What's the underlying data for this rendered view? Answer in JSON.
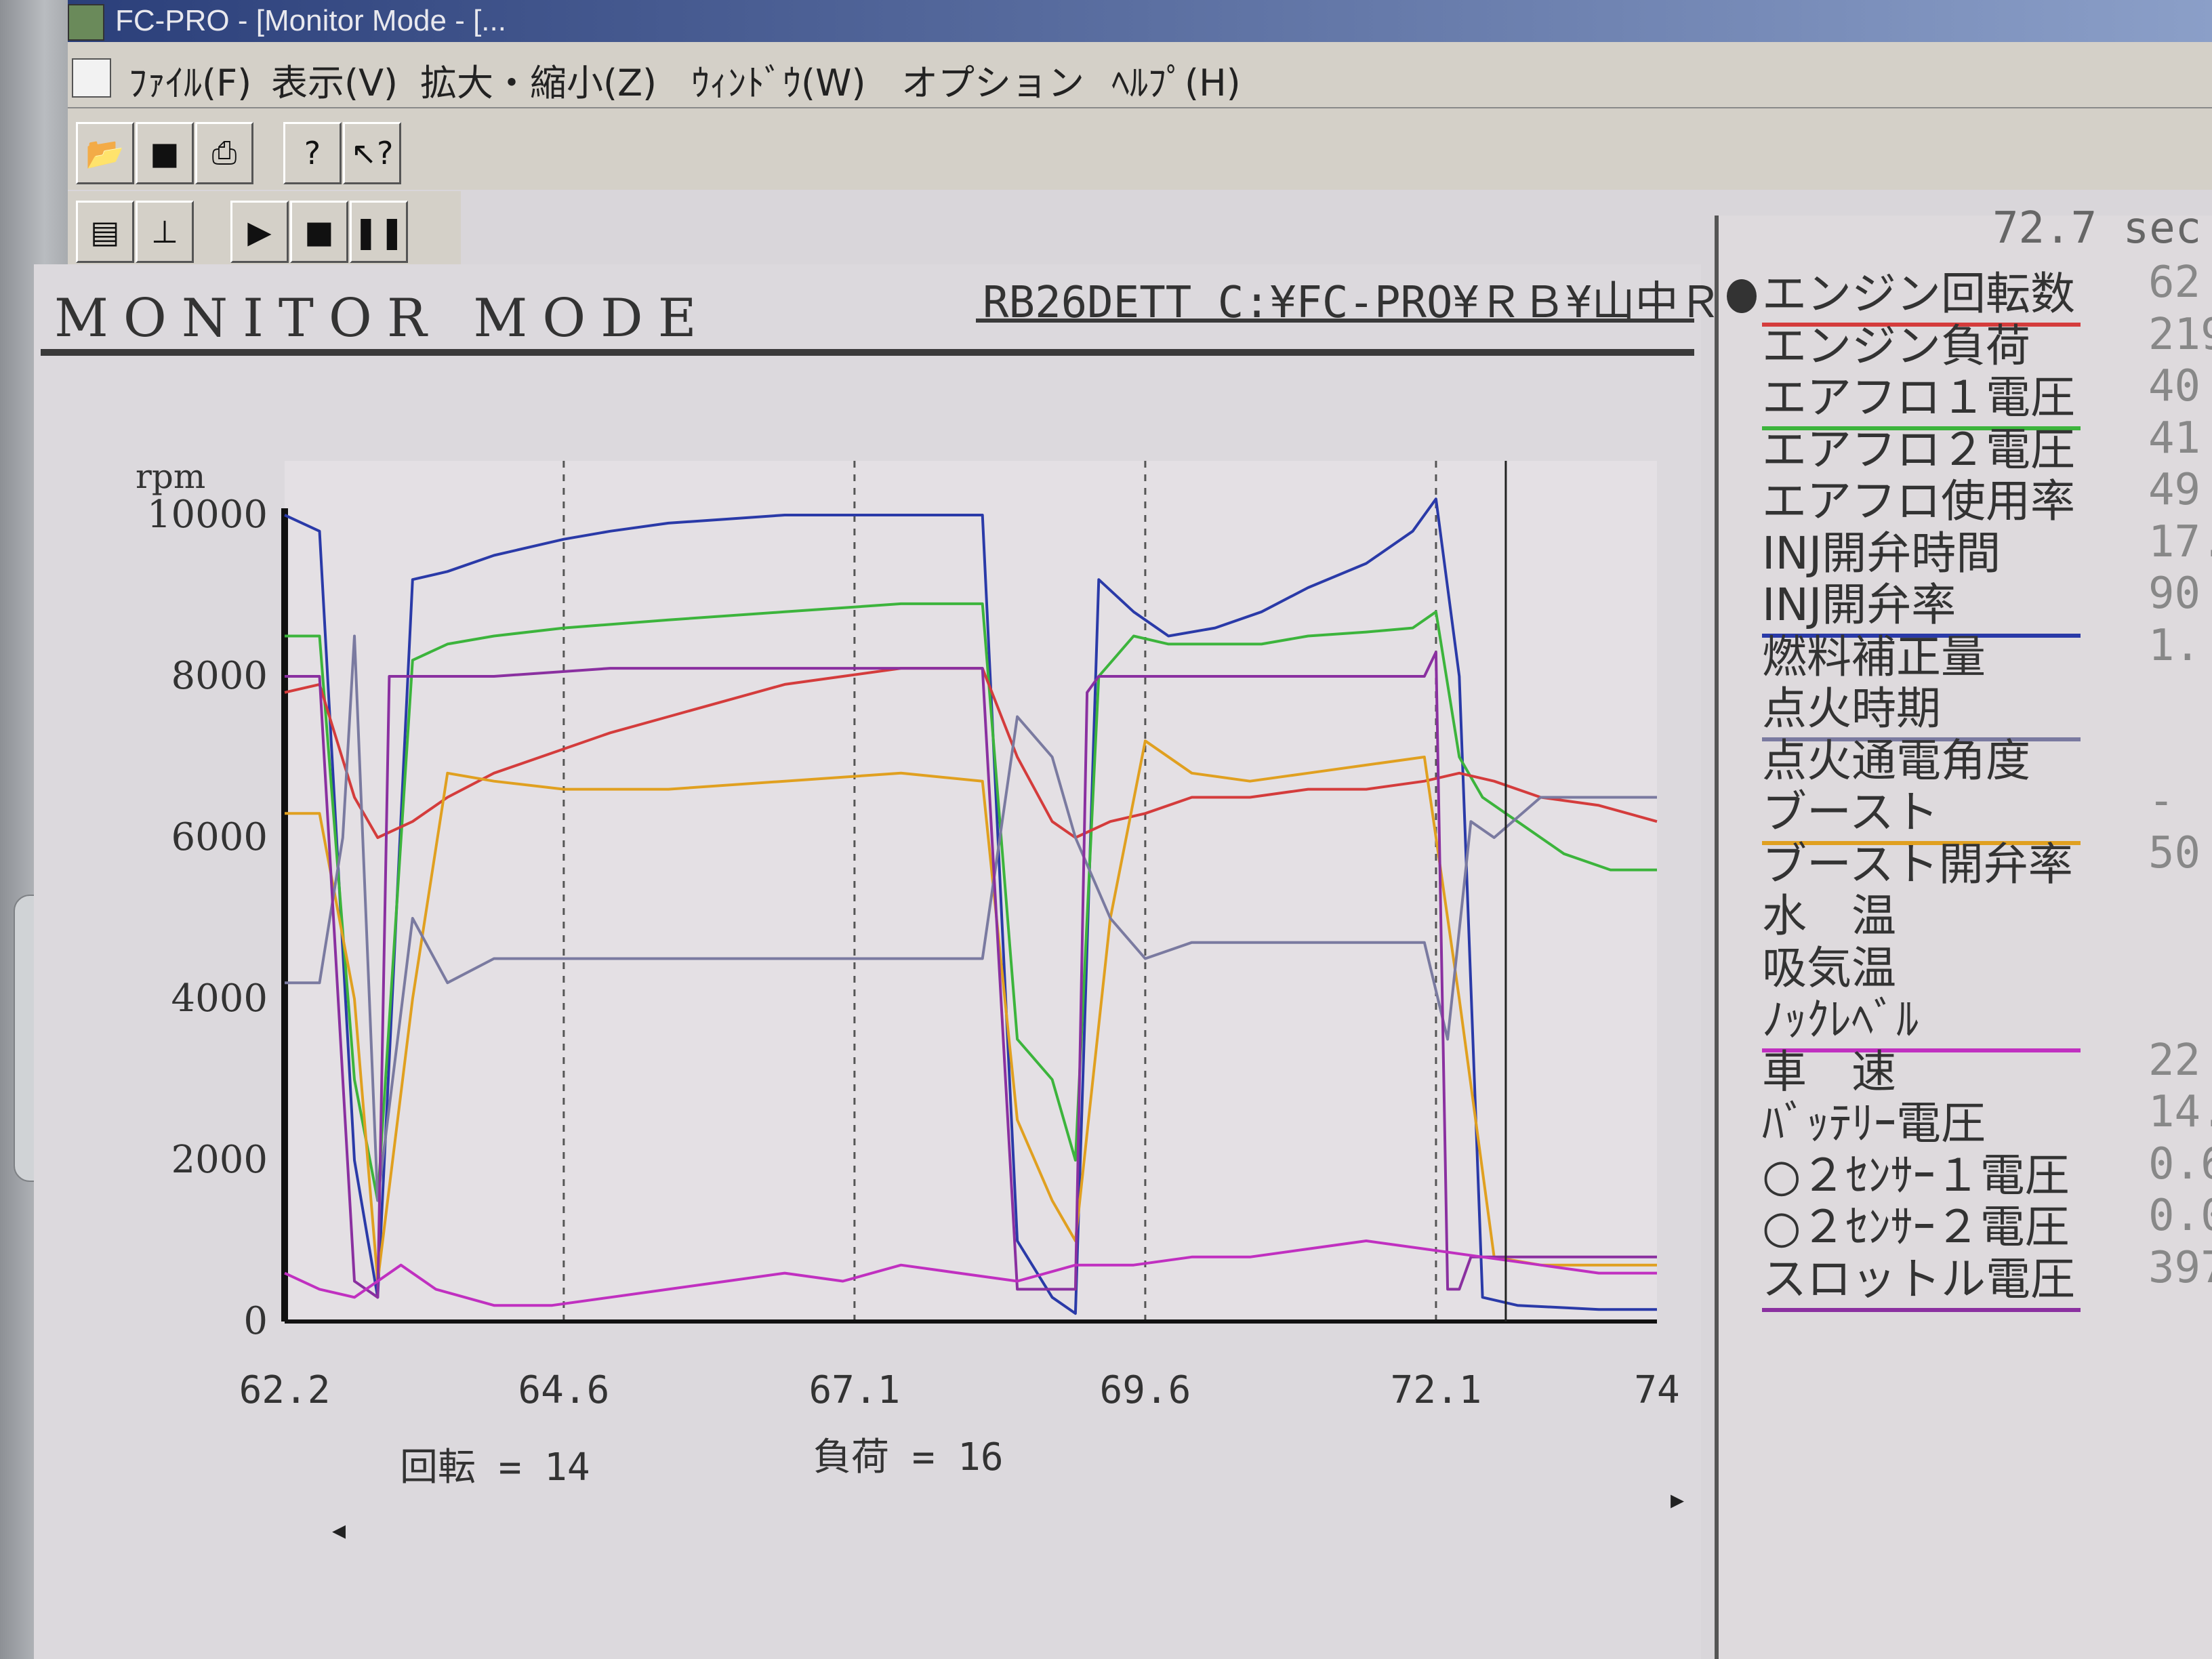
{
  "window": {
    "title": "FC-PRO - [Monitor Mode - [..."
  },
  "menu": [
    {
      "id": "file",
      "label": "ﾌｧｲﾙ(F)"
    },
    {
      "id": "view",
      "label": "表示(V)"
    },
    {
      "id": "zoom",
      "label": "拡大・縮小(Z)"
    },
    {
      "id": "window",
      "label": "ｳｨﾝﾄﾞｳ(W)"
    },
    {
      "id": "options",
      "label": "オプション"
    },
    {
      "id": "help",
      "label": "ﾍﾙﾌﾟ(H)"
    }
  ],
  "toolbar": {
    "open_icon": "folder-open-icon",
    "save_icon": "floppy-icon",
    "print_icon": "printer-icon",
    "help_icon": "question-icon",
    "context_help_icon": "context-help-icon",
    "chart_icon": "chart-icon",
    "marker_icon": "marker-icon",
    "play_icon": "play-icon",
    "stop_icon": "stop-icon",
    "pause_icon": "pause-icon"
  },
  "monitor": {
    "mode_title": "MONITOR MODE",
    "file_path": "RB26DETT C:¥FC-PRO¥ＲＢ¥山中Ｒ３",
    "time_readout": "72.7 sec"
  },
  "status": {
    "rev_label": "回転 = 14",
    "load_label": "負荷 = 16"
  },
  "params": [
    {
      "name": "エンジン回転数",
      "value": "62",
      "color": "#d43c3c",
      "selected": true
    },
    {
      "name": "エンジン負荷",
      "value": "219",
      "color": ""
    },
    {
      "name": "エアフロ１電圧",
      "value": "40",
      "color": "#3cb43c"
    },
    {
      "name": "エアフロ２電圧",
      "value": "41",
      "color": ""
    },
    {
      "name": "エアフロ使用率",
      "value": "49",
      "color": ""
    },
    {
      "name": "INJ開弁時間",
      "value": "17.",
      "color": ""
    },
    {
      "name": "INJ開弁率",
      "value": "90",
      "color": "#2a3aa8"
    },
    {
      "name": "燃料補正量",
      "value": "1.",
      "color": ""
    },
    {
      "name": "点火時期",
      "value": "",
      "color": "#7a7aa0"
    },
    {
      "name": "点火通電角度",
      "value": "",
      "color": ""
    },
    {
      "name": "ブースト",
      "value": "-",
      "color": "#e0a020"
    },
    {
      "name": "ブースト開弁率",
      "value": "50",
      "color": ""
    },
    {
      "name": "水　温",
      "value": "",
      "color": ""
    },
    {
      "name": "吸気温",
      "value": "",
      "color": ""
    },
    {
      "name": "ﾉｯｸﾚﾍﾞﾙ",
      "value": "",
      "color": "#c030c0"
    },
    {
      "name": "車　速",
      "value": "22",
      "color": ""
    },
    {
      "name": "ﾊﾞｯﾃﾘｰ電圧",
      "value": "14.",
      "color": ""
    },
    {
      "name": "○２ｾﾝｻｰ１電圧",
      "value": "0.6",
      "color": ""
    },
    {
      "name": "○２ｾﾝｻｰ２電圧",
      "value": "0.0",
      "color": ""
    },
    {
      "name": "スロットル電圧",
      "value": "397",
      "color": "#8a30a0"
    }
  ],
  "chart_data": {
    "type": "line",
    "title": "",
    "xlabel": "",
    "ylabel": "rpm",
    "ylim": [
      0,
      10000
    ],
    "xlim": [
      62.2,
      74
    ],
    "x_ticks": [
      "62.2",
      "64.6",
      "67.1",
      "69.6",
      "72.1",
      "74"
    ],
    "y_ticks": [
      "0",
      "2000",
      "4000",
      "6000",
      "8000",
      "10000"
    ],
    "grid": "vertical dashed",
    "cursor_x": 72.7,
    "series": [
      {
        "name": "INJ開弁率",
        "color": "#2a3aa8",
        "x": [
          62.2,
          62.5,
          62.8,
          63.0,
          63.3,
          63.6,
          64.0,
          64.6,
          65.0,
          65.5,
          66.0,
          66.5,
          67.0,
          67.5,
          68.2,
          68.5,
          68.8,
          69.0,
          69.2,
          69.5,
          69.8,
          70.2,
          70.6,
          71.0,
          71.5,
          71.9,
          72.1,
          72.3,
          72.5,
          72.8,
          73.5,
          74.0
        ],
        "y": [
          10000,
          9800,
          2000,
          300,
          9200,
          9300,
          9500,
          9700,
          9800,
          9900,
          9950,
          10000,
          10000,
          10000,
          10000,
          1000,
          300,
          100,
          9200,
          8800,
          8500,
          8600,
          8800,
          9100,
          9400,
          9800,
          10200,
          8000,
          300,
          200,
          150,
          150
        ]
      },
      {
        "name": "エアフロ１電圧",
        "color": "#3cb43c",
        "x": [
          62.2,
          62.5,
          62.8,
          63.0,
          63.3,
          63.6,
          64.0,
          64.6,
          65.5,
          66.5,
          67.5,
          68.2,
          68.5,
          68.8,
          69.0,
          69.2,
          69.5,
          69.8,
          70.2,
          70.6,
          71.0,
          71.5,
          71.9,
          72.1,
          72.3,
          72.5,
          72.8,
          73.2,
          73.6,
          74.0
        ],
        "y": [
          8500,
          8500,
          3000,
          1500,
          8200,
          8400,
          8500,
          8600,
          8700,
          8800,
          8900,
          8900,
          3500,
          3000,
          2000,
          8000,
          8500,
          8400,
          8400,
          8400,
          8500,
          8550,
          8600,
          8800,
          7000,
          6500,
          6200,
          5800,
          5600,
          5600
        ]
      },
      {
        "name": "エンジン回転数",
        "color": "#d43c3c",
        "x": [
          62.2,
          62.5,
          62.8,
          63.0,
          63.3,
          63.6,
          64.0,
          64.6,
          65.0,
          65.5,
          66.0,
          66.5,
          67.0,
          67.5,
          68.2,
          68.5,
          68.8,
          69.0,
          69.3,
          69.6,
          70.0,
          70.5,
          71.0,
          71.5,
          72.0,
          72.3,
          72.6,
          73.0,
          73.5,
          74.0
        ],
        "y": [
          7800,
          7900,
          6500,
          6000,
          6200,
          6500,
          6800,
          7100,
          7300,
          7500,
          7700,
          7900,
          8000,
          8100,
          8100,
          7000,
          6200,
          6000,
          6200,
          6300,
          6500,
          6500,
          6600,
          6600,
          6700,
          6800,
          6700,
          6500,
          6400,
          6200
        ]
      },
      {
        "name": "ブースト",
        "color": "#e0a020",
        "x": [
          62.2,
          62.5,
          62.8,
          63.0,
          63.3,
          63.6,
          64.0,
          64.6,
          65.5,
          66.5,
          67.5,
          68.2,
          68.5,
          68.8,
          69.0,
          69.3,
          69.6,
          70.0,
          70.5,
          71.0,
          71.5,
          72.0,
          72.3,
          72.6,
          73.0,
          73.5,
          74.0
        ],
        "y": [
          6300,
          6300,
          4000,
          500,
          4000,
          6800,
          6700,
          6600,
          6600,
          6700,
          6800,
          6700,
          2500,
          1500,
          1000,
          5000,
          7200,
          6800,
          6700,
          6800,
          6900,
          7000,
          4000,
          800,
          700,
          700,
          700
        ]
      },
      {
        "name": "点火時期",
        "color": "#7a7aa0",
        "x": [
          62.2,
          62.5,
          62.7,
          62.8,
          63.0,
          63.3,
          63.6,
          64.0,
          64.6,
          65.5,
          66.5,
          67.5,
          68.2,
          68.5,
          68.8,
          69.0,
          69.3,
          69.6,
          70.0,
          70.5,
          71.0,
          71.5,
          72.0,
          72.2,
          72.4,
          72.6,
          73.0,
          73.5,
          74.0
        ],
        "y": [
          4200,
          4200,
          6000,
          8500,
          1500,
          5000,
          4200,
          4500,
          4500,
          4500,
          4500,
          4500,
          4500,
          7500,
          7000,
          6000,
          5000,
          4500,
          4700,
          4700,
          4700,
          4700,
          4700,
          3500,
          6200,
          6000,
          6500,
          6500,
          6500
        ]
      },
      {
        "name": "スロットル電圧",
        "color": "#8a30a0",
        "x": [
          62.2,
          62.5,
          62.8,
          63.0,
          63.1,
          63.2,
          63.5,
          64.0,
          65.0,
          66.0,
          67.0,
          68.0,
          68.2,
          68.5,
          68.8,
          69.0,
          69.1,
          69.2,
          70.0,
          71.0,
          72.0,
          72.1,
          72.2,
          72.3,
          72.4,
          73.0,
          73.5,
          74.0
        ],
        "y": [
          8000,
          8000,
          500,
          300,
          8000,
          8000,
          8000,
          8000,
          8100,
          8100,
          8100,
          8100,
          8100,
          400,
          400,
          400,
          7800,
          8000,
          8000,
          8000,
          8000,
          8300,
          400,
          400,
          800,
          800,
          800,
          800
        ]
      },
      {
        "name": "ﾉｯｸﾚﾍﾞﾙ",
        "color": "#c030c0",
        "x": [
          62.2,
          62.5,
          62.8,
          63.2,
          63.5,
          64.0,
          64.5,
          65.0,
          65.5,
          66.0,
          66.5,
          67.0,
          67.5,
          68.0,
          68.5,
          69.0,
          69.5,
          70.0,
          70.5,
          71.0,
          71.5,
          72.0,
          72.5,
          73.0,
          73.5,
          74.0
        ],
        "y": [
          600,
          400,
          300,
          700,
          400,
          200,
          200,
          300,
          400,
          500,
          600,
          500,
          700,
          600,
          500,
          700,
          700,
          800,
          800,
          900,
          1000,
          900,
          800,
          700,
          600,
          600
        ]
      }
    ]
  }
}
